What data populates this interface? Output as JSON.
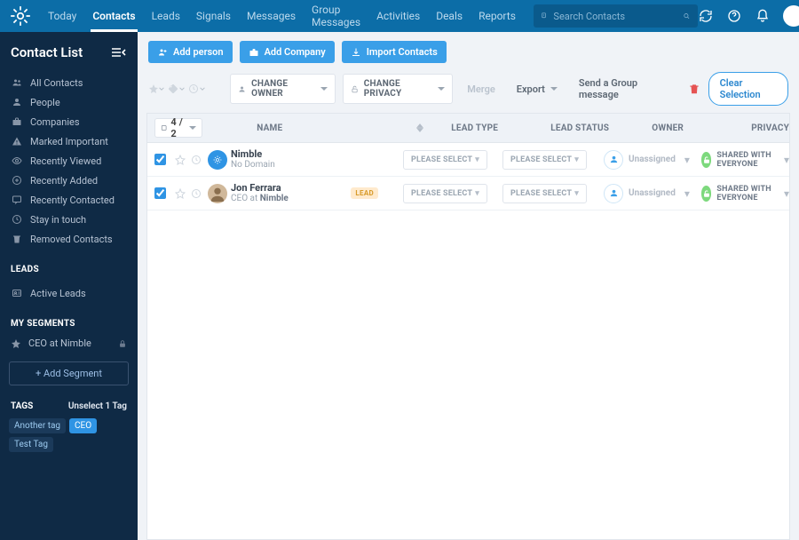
{
  "topnav": {
    "items": [
      "Today",
      "Contacts",
      "Leads",
      "Signals",
      "Messages",
      "Group Messages",
      "Activities",
      "Deals",
      "Reports"
    ],
    "active_index": 1,
    "search_placeholder": "Search Contacts"
  },
  "sidebar": {
    "title": "Contact List",
    "nav": [
      {
        "icon": "users",
        "label": "All Contacts"
      },
      {
        "icon": "person",
        "label": "People"
      },
      {
        "icon": "briefcase",
        "label": "Companies"
      },
      {
        "icon": "warn",
        "label": "Marked Important"
      },
      {
        "icon": "eye",
        "label": "Recently Viewed"
      },
      {
        "icon": "plus-circle",
        "label": "Recently Added"
      },
      {
        "icon": "speech",
        "label": "Recently Contacted"
      },
      {
        "icon": "clock",
        "label": "Stay in touch"
      },
      {
        "icon": "trash",
        "label": "Removed Contacts"
      }
    ],
    "leads_header": "LEADS",
    "leads": [
      {
        "icon": "id",
        "label": "Active Leads"
      }
    ],
    "segments_header": "MY SEGMENTS",
    "segments": [
      {
        "icon": "star",
        "label": "CEO at Nimble",
        "locked": true
      }
    ],
    "add_segment": "+ Add Segment",
    "tags_header": "TAGS",
    "unselect_label": "Unselect 1 Tag",
    "tags": [
      {
        "label": "Another tag",
        "active": false
      },
      {
        "label": "CEO",
        "active": true
      },
      {
        "label": "Test Tag",
        "active": false
      }
    ]
  },
  "actions": {
    "add_person": "Add person",
    "add_company": "Add Company",
    "import": "Import Contacts"
  },
  "toolbar": {
    "change_owner": "CHANGE OWNER",
    "change_privacy": "CHANGE PRIVACY",
    "merge": "Merge",
    "export": "Export",
    "group_msg": "Send a Group message",
    "clear": "Clear Selection"
  },
  "table": {
    "select_label": "4 / 2",
    "headers": {
      "name": "NAME",
      "lead_type": "LEAD TYPE",
      "lead_status": "LEAD STATUS",
      "owner": "OWNER",
      "privacy": "PRIVACY"
    },
    "please_select": "PLEASE SELECT",
    "unassigned": "Unassigned",
    "shared": "SHARED WITH EVERYONE",
    "lead_badge": "LEAD",
    "rows": [
      {
        "checked": true,
        "avatar_color": "#2f94e4",
        "avatar_type": "logo",
        "name": "Nimble",
        "sub_plain": "No Domain",
        "is_lead": false
      },
      {
        "checked": true,
        "avatar_color": "#c5b197",
        "avatar_type": "photo",
        "name": "Jon Ferrara",
        "sub_prefix": "CEO at ",
        "sub_bold": "Nimble",
        "is_lead": true
      }
    ]
  }
}
